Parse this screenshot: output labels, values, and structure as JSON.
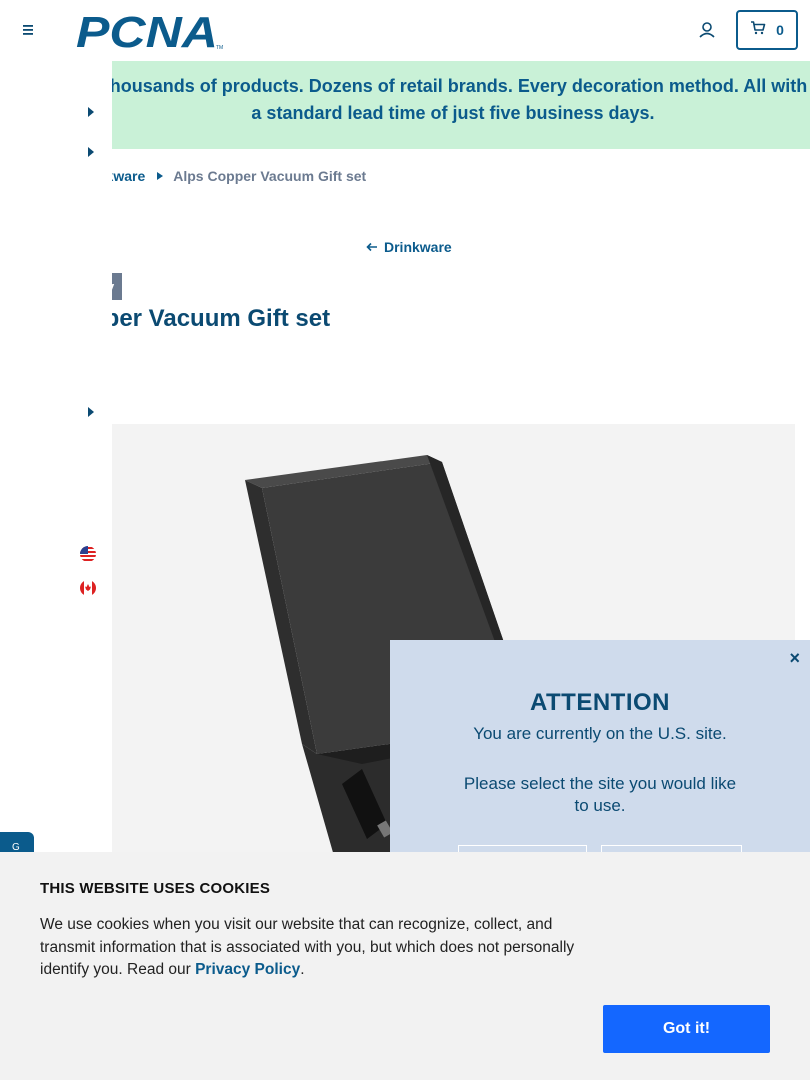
{
  "header": {
    "logo_text": "PCNA",
    "logo_tm": "TM",
    "cart_count": "0",
    "menu_icon": "hamburger-icon",
    "account_icon": "user-icon",
    "cart_icon": "cart-icon"
  },
  "banner": {
    "text": "Thousands of products. Dozens of retail brands. Every decoration method. All with a standard lead time of just five business days."
  },
  "breadcrumb": {
    "parent": "Drinkware",
    "parent_visible": "nkware",
    "current": "Alps Copper Vacuum Gift set"
  },
  "back_link": {
    "label": "Drinkware"
  },
  "product": {
    "category_badge": "ry",
    "title": "pper Vacuum Gift set"
  },
  "drawer": {
    "flags": [
      "us-flag-icon",
      "canada-flag-icon"
    ]
  },
  "modal": {
    "title": "ATTENTION",
    "text1": "You are currently on the U.S. site.",
    "text2": "Please select the site you would like to use.",
    "close": "×"
  },
  "cookie": {
    "title": "THIS WEBSITE USES COOKIES",
    "text_before": "We use cookies when you visit our website that can recognize, collect, and transmit information that is associated with you, but which does not personally identify you. Read our ",
    "link": "Privacy Policy",
    "text_after": ".",
    "button": "Got it!"
  },
  "side_tab": {
    "label": "G"
  },
  "colors": {
    "brand": "#0b5b8c",
    "banner_bg": "#c9f1d7",
    "modal_bg": "#cfdbec",
    "cookie_button": "#1467ff",
    "badge_bg": "#6b7a90"
  }
}
